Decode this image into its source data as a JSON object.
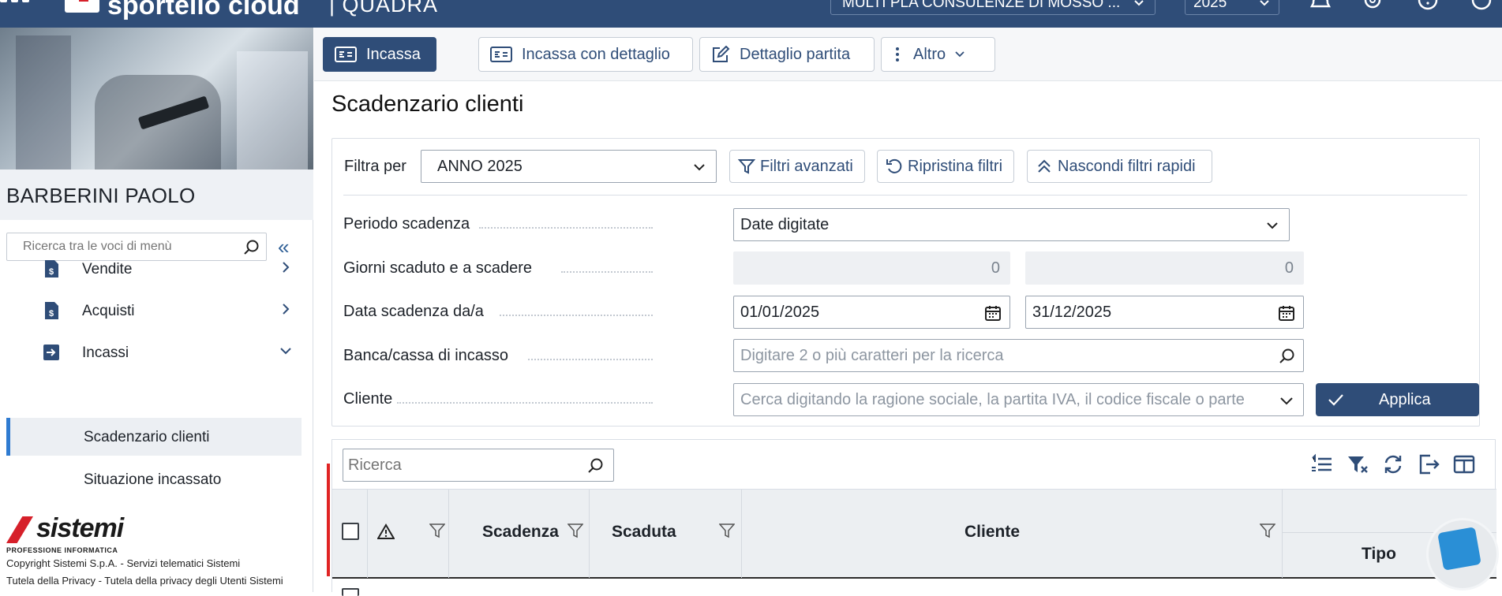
{
  "topbar": {
    "brand": "sportello cloud",
    "product": "| QUADRA",
    "company": "MULTI PLA CONSULENZE DI MOSSO ...",
    "year": "2025"
  },
  "sidebar": {
    "user_name": "BARBERINI PAOLO",
    "search_placeholder": "Ricerca tra le voci di menù",
    "collapse": "«",
    "items": [
      {
        "label": "Vendite"
      },
      {
        "label": "Acquisti"
      },
      {
        "label": "Incassi"
      }
    ],
    "sub_items": [
      {
        "label": "Scadenzario clienti"
      },
      {
        "label": "Situazione incassato"
      }
    ],
    "logo_word": "sistemi",
    "logo_tag": "PROFESSIONE INFORMATICA",
    "copyright": "Copyright Sistemi S.p.A. - Servizi telematici Sistemi",
    "privacy": "Tutela della Privacy - Tutela della privacy degli Utenti Sistemi"
  },
  "toolbar": {
    "incassa": "Incassa",
    "incassa_dettaglio": "Incassa con dettaglio",
    "dettaglio_partita": "Dettaglio partita",
    "altro": "Altro"
  },
  "page": {
    "title": "Scadenzario clienti"
  },
  "filters": {
    "filtra_per_label": "Filtra per",
    "filtra_per_value": "ANNO 2025",
    "advanced": "Filtri avanzati",
    "reset": "Ripristina filtri",
    "hide_quick": "Nascondi filtri rapidi",
    "periodo_label": "Periodo scadenza",
    "periodo_value": "Date digitate",
    "giorni_label": "Giorni scaduto e a scadere",
    "giorni_from": "0",
    "giorni_to": "0",
    "data_label": "Data scadenza da/a",
    "data_from": "01/01/2025",
    "data_to": "31/12/2025",
    "banca_label": "Banca/cassa di incasso",
    "banca_placeholder": "Digitare 2 o più caratteri per la ricerca",
    "cliente_label": "Cliente",
    "cliente_placeholder": "Cerca digitando la ragione sociale, la partita IVA, il codice fiscale o parte",
    "apply": "Applica"
  },
  "grid": {
    "search_placeholder": "Ricerca",
    "columns": {
      "scadenza": "Scadenza",
      "scaduta": "Scaduta",
      "cliente": "Cliente",
      "tipo": "Tipo"
    }
  },
  "colors": {
    "primary": "#2f4d78",
    "accent": "#2f7bd1",
    "logo_red": "#d6202a"
  }
}
